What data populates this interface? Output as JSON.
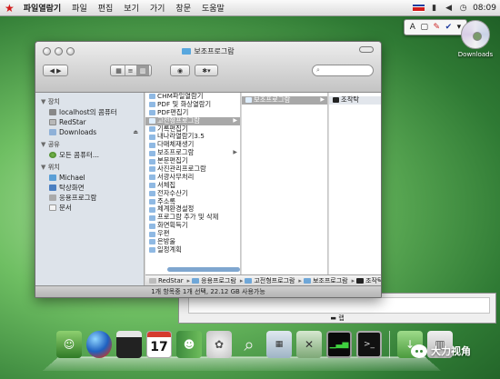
{
  "menubar": {
    "items": [
      "파일열람기",
      "파일",
      "편집",
      "보기",
      "가기",
      "창문",
      "도움말"
    ],
    "clock": "08:09"
  },
  "palette": {
    "letter": "A"
  },
  "desktop": {
    "icon_label": "Downloads"
  },
  "window": {
    "title": "보조프로그람",
    "sidebar": {
      "groups": [
        {
          "label": "장치",
          "items": [
            "localhost의 콤퓨터",
            "RedStar",
            "Downloads"
          ]
        },
        {
          "label": "공유",
          "items": [
            "모든 콤퓨터..."
          ]
        },
        {
          "label": "위치",
          "items": [
            "Michael",
            "탁상화면",
            "응용프로그람",
            "문서"
          ]
        }
      ]
    },
    "column1": {
      "items": [
        "CHM파일열람기",
        "PDF 및 화상열람기",
        "PDF편집기",
        "고전형프로그람",
        "기록편집기",
        "내나라열람기3.5",
        "다매체재생기",
        "보조프로그람",
        "본문편집기",
        "사진관리프로그람",
        "서광사무처리",
        "서체집",
        "전자수산기",
        "주소록",
        "체계환경설정",
        "프로그람 추가 및 삭제",
        "화면획득기",
        "우편",
        "은방울",
        "일정계획"
      ],
      "selected_index": 3
    },
    "column2": {
      "items": [
        "보조프로그람"
      ]
    },
    "column3": {
      "items": [
        "조작탁"
      ]
    },
    "pathbar": [
      "RedStar",
      "응용프로그람",
      "고전형프로그람",
      "보조프로그람",
      "조작탁"
    ],
    "status": "1개 항목중 1개 선택, 22.12 GB 사용가능"
  },
  "back_window": {
    "footer": "랩"
  },
  "dock": {
    "calendar_day": "17"
  },
  "watermark": {
    "text": "大力视角"
  }
}
